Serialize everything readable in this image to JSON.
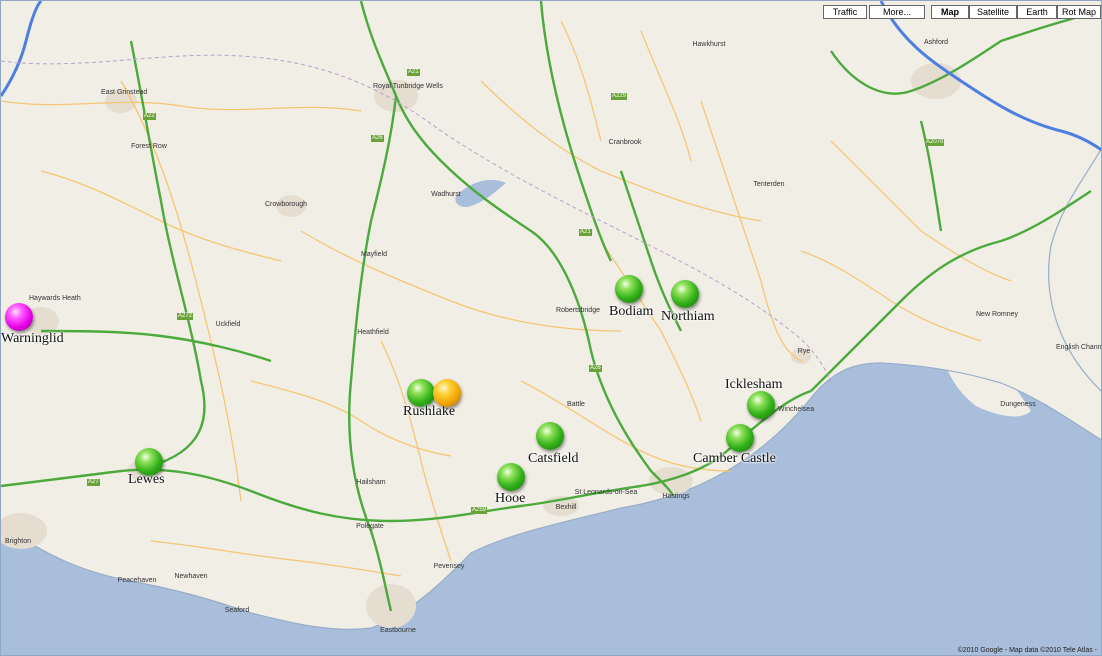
{
  "map_type_buttons": [
    {
      "id": "traffic",
      "label": "Traffic"
    },
    {
      "id": "more",
      "label": "More..."
    },
    {
      "id": "map",
      "label": "Map"
    },
    {
      "id": "satellite",
      "label": "Satellite"
    },
    {
      "id": "earth",
      "label": "Earth"
    },
    {
      "id": "rotmap",
      "label": "Rot Map"
    }
  ],
  "markers": [
    {
      "id": "warninglid",
      "color": "magenta",
      "label": "Warninglid"
    },
    {
      "id": "lewes",
      "color": "green",
      "label": "Lewes"
    },
    {
      "id": "rushlake",
      "color": "green",
      "label": "Rushlake"
    },
    {
      "id": "rushlake_alt",
      "color": "orange",
      "label": ""
    },
    {
      "id": "hooe",
      "color": "green",
      "label": "Hooe"
    },
    {
      "id": "catsfield",
      "color": "green",
      "label": "Catsfield"
    },
    {
      "id": "bodiam",
      "color": "green",
      "label": "Bodiam"
    },
    {
      "id": "northiam",
      "color": "green",
      "label": "Northiam"
    },
    {
      "id": "icklesham",
      "color": "green",
      "label": "Icklesham"
    },
    {
      "id": "camber_castle",
      "color": "green",
      "label": "Camber Castle"
    }
  ],
  "towns": [
    {
      "id": "tunbridge",
      "text": "Royal Tunbridge Wells"
    },
    {
      "id": "ashford",
      "text": "Ashford"
    },
    {
      "id": "eastbourne",
      "text": "Eastbourne"
    },
    {
      "id": "hastings",
      "text": "Hastings"
    },
    {
      "id": "brighton",
      "text": "Brighton"
    },
    {
      "id": "haywards",
      "text": "Haywards Heath"
    },
    {
      "id": "crowborough",
      "text": "Crowborough"
    },
    {
      "id": "wadhurst",
      "text": "Wadhurst"
    },
    {
      "id": "heathfield",
      "text": "Heathfield"
    },
    {
      "id": "hailsham",
      "text": "Hailsham"
    },
    {
      "id": "battle",
      "text": "Battle"
    },
    {
      "id": "bexhill",
      "text": "Bexhill"
    },
    {
      "id": "rye",
      "text": "Rye"
    },
    {
      "id": "tenterden",
      "text": "Tenterden"
    },
    {
      "id": "cranbrook",
      "text": "Cranbrook"
    },
    {
      "id": "uckfield",
      "text": "Uckfield"
    },
    {
      "id": "newhaven",
      "text": "Newhaven"
    },
    {
      "id": "seaford",
      "text": "Seaford"
    },
    {
      "id": "robertsbridge",
      "text": "Robertsbridge"
    },
    {
      "id": "mayfield",
      "text": "Mayfield"
    },
    {
      "id": "stleonards",
      "text": "St Leonards-on-Sea"
    },
    {
      "id": "pevensey",
      "text": "Pevensey"
    },
    {
      "id": "dungeness",
      "text": "Dungeness"
    },
    {
      "id": "newromney",
      "text": "New Romney"
    },
    {
      "id": "forestrow",
      "text": "Forest Row"
    },
    {
      "id": "eastgrinstead",
      "text": "East Grinstead"
    },
    {
      "id": "hawkhurst",
      "text": "Hawkhurst"
    },
    {
      "id": "winchelsea",
      "text": "Winchelsea"
    },
    {
      "id": "polegate",
      "text": "Polegate"
    },
    {
      "id": "peacehaven",
      "text": "Peacehaven"
    },
    {
      "id": "englishchannel",
      "text": "English Channel"
    }
  ],
  "roads": [
    {
      "id": "a21a",
      "text": "A21"
    },
    {
      "id": "a21b",
      "text": "A21"
    },
    {
      "id": "a22",
      "text": "A22"
    },
    {
      "id": "a26",
      "text": "A26"
    },
    {
      "id": "a27",
      "text": "A27"
    },
    {
      "id": "a259",
      "text": "A259"
    },
    {
      "id": "a28",
      "text": "A28"
    },
    {
      "id": "a229",
      "text": "A229"
    },
    {
      "id": "a2070",
      "text": "A2070"
    },
    {
      "id": "a272",
      "text": "A272"
    }
  ],
  "credit": "©2010 Google - Map data ©2010 Tele Atlas -"
}
